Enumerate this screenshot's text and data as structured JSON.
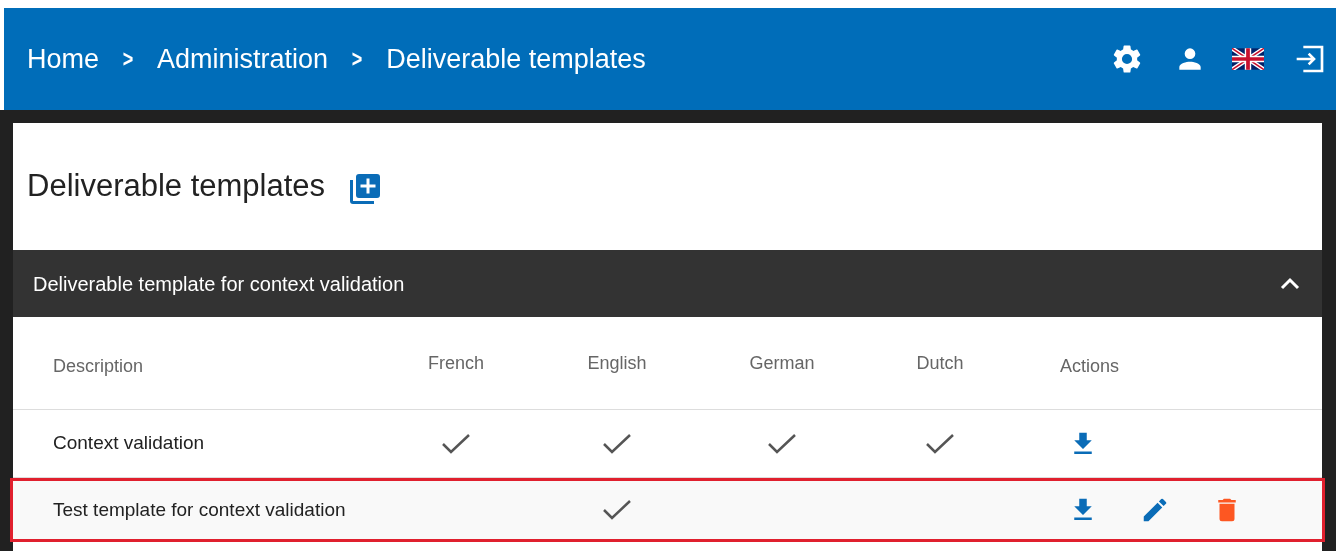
{
  "breadcrumb": [
    {
      "label": "Home"
    },
    {
      "label": "Administration"
    },
    {
      "label": "Deliverable templates"
    }
  ],
  "separator": ">",
  "page_title": "Deliverable templates",
  "panel": {
    "title": "Deliverable template for context validation",
    "expanded": true
  },
  "table": {
    "columns": [
      "Description",
      "French",
      "English",
      "German",
      "Dutch",
      "Actions"
    ],
    "rows": [
      {
        "description": "Context validation",
        "french": true,
        "english": true,
        "german": true,
        "dutch": true,
        "actions": {
          "download": true,
          "edit": false,
          "delete": false
        },
        "highlighted": false
      },
      {
        "description": "Test template for context validation",
        "french": false,
        "english": true,
        "german": false,
        "dutch": false,
        "actions": {
          "download": true,
          "edit": true,
          "delete": true
        },
        "highlighted": true
      }
    ]
  }
}
